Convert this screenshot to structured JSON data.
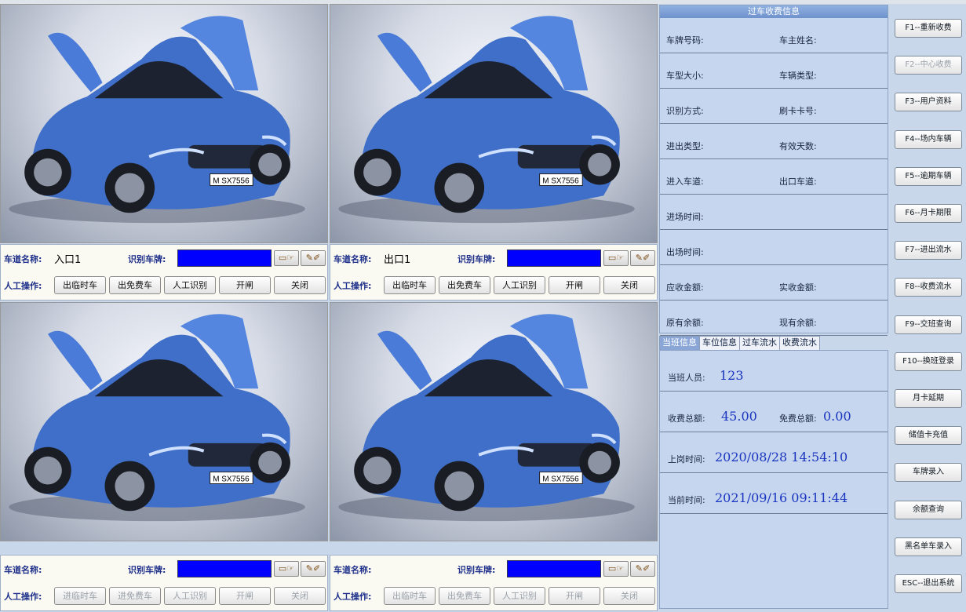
{
  "lanes": [
    {
      "name_label": "车道名称:",
      "name": "入口1",
      "plate_label": "识别车牌:",
      "op_label": "人工操作:",
      "buttons": [
        "出临时车",
        "出免费车",
        "人工识别",
        "开闸",
        "关闭"
      ],
      "disabled": false
    },
    {
      "name_label": "车道名称:",
      "name": "出口1",
      "plate_label": "识别车牌:",
      "op_label": "人工操作:",
      "buttons": [
        "出临时车",
        "出免费车",
        "人工识别",
        "开闸",
        "关闭"
      ],
      "disabled": false
    },
    {
      "name_label": "车道名称:",
      "name": "",
      "plate_label": "识别车牌:",
      "op_label": "人工操作:",
      "buttons": [
        "进临时车",
        "进免费车",
        "人工识别",
        "开闸",
        "关闭"
      ],
      "disabled": true
    },
    {
      "name_label": "车道名称:",
      "name": "",
      "plate_label": "识别车牌:",
      "op_label": "人工操作:",
      "buttons": [
        "出临时车",
        "出免费车",
        "人工识别",
        "开闸",
        "关闭"
      ],
      "disabled": true
    }
  ],
  "camera_plate": "M SX7556",
  "info": {
    "title": "过车收费信息",
    "rows": [
      [
        "车牌号码:",
        "车主姓名:"
      ],
      [
        "车型大小:",
        "车辆类型:"
      ],
      [
        "识别方式:",
        "刷卡卡号:"
      ],
      [
        "进出类型:",
        "有效天数:"
      ],
      [
        "进入车道:",
        "出口车道:"
      ],
      [
        "进场时间:",
        ""
      ],
      [
        "出场时间:",
        ""
      ],
      [
        "应收金额:",
        "实收金额:"
      ],
      [
        "原有余额:",
        "现有余额:"
      ]
    ]
  },
  "tabs": [
    "当班信息",
    "车位信息",
    "过车流水",
    "收费流水"
  ],
  "shift": {
    "operator_label": "当班人员:",
    "operator": "123",
    "total_label": "收费总额:",
    "total": "45.00",
    "free_label": "免费总额:",
    "free": "0.00",
    "login_label": "上岗时间:",
    "login": "2020/08/28 14:54:10",
    "now_label": "当前时间:",
    "now": "2021/09/16 09:11:44"
  },
  "side_buttons": [
    {
      "label": "F1--重新收费",
      "disabled": false
    },
    {
      "label": "F2--中心收费",
      "disabled": true
    },
    {
      "label": "F3--用户资料",
      "disabled": false
    },
    {
      "label": "F4--场内车辆",
      "disabled": false
    },
    {
      "label": "F5--逾期车辆",
      "disabled": false
    },
    {
      "label": "F6--月卡期限",
      "disabled": false
    },
    {
      "label": "F7--进出流水",
      "disabled": false
    },
    {
      "label": "F8--收费流水",
      "disabled": false
    },
    {
      "label": "F9--交班查询",
      "disabled": false
    },
    {
      "label": "F10--换班登录",
      "disabled": false
    },
    {
      "label": "月卡延期",
      "disabled": false
    },
    {
      "label": "储值卡充值",
      "disabled": false
    },
    {
      "label": "车牌录入",
      "disabled": false
    },
    {
      "label": "余额查询",
      "disabled": false
    },
    {
      "label": "黑名单车录入",
      "disabled": false
    },
    {
      "label": "ESC--退出系统",
      "disabled": false
    }
  ]
}
